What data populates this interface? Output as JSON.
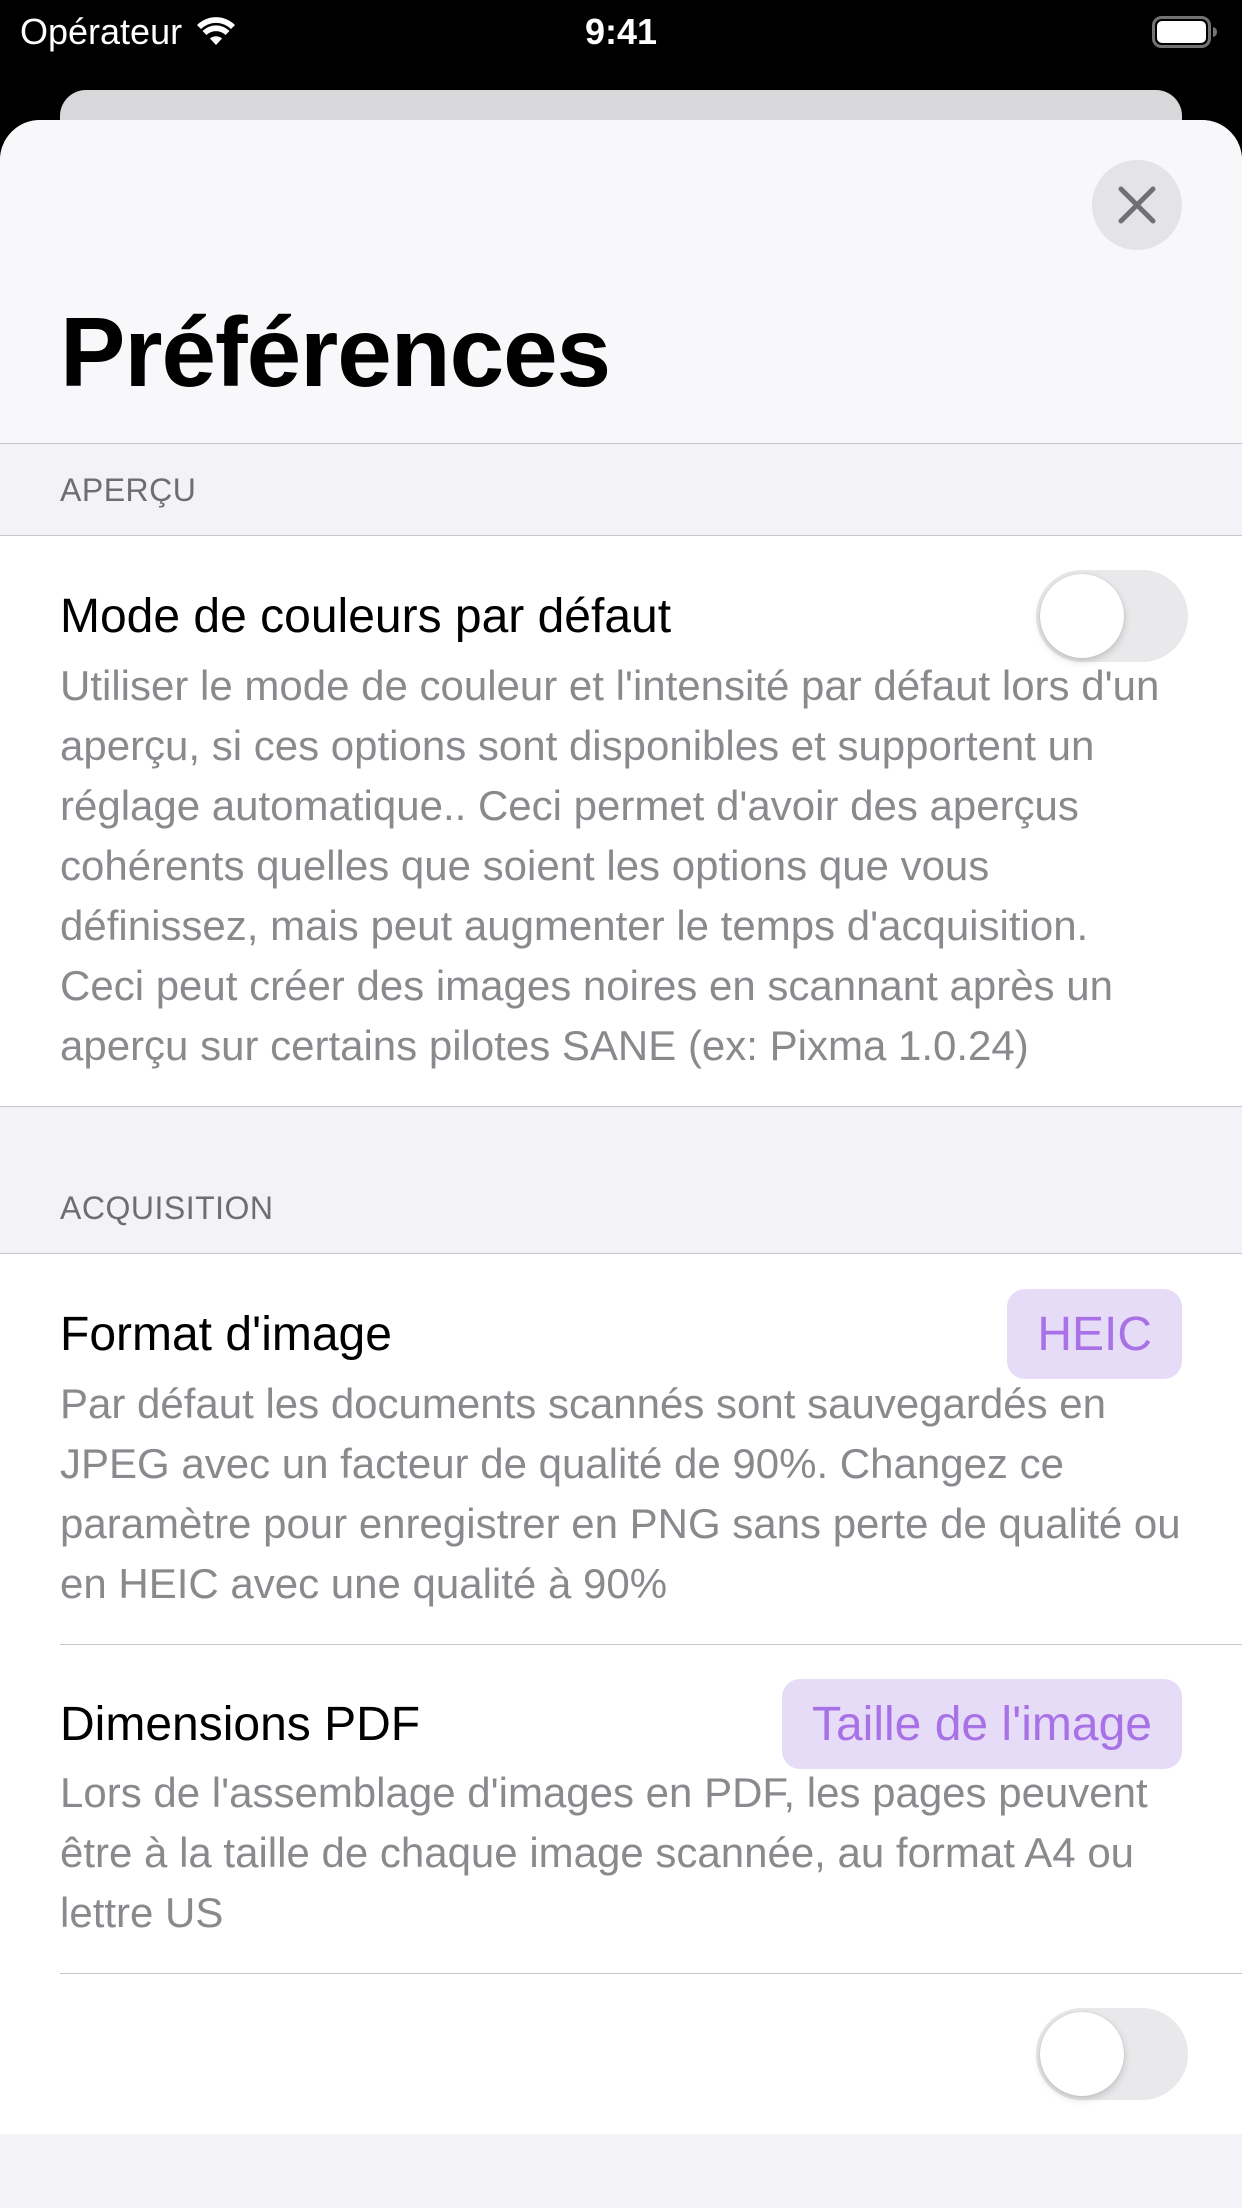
{
  "status_bar": {
    "carrier": "Opérateur",
    "time": "9:41"
  },
  "header": {
    "title": "Préférences",
    "close_icon": "close-icon"
  },
  "sections": {
    "apercu": {
      "header": "APERÇU",
      "default_color_mode": {
        "label": "Mode de couleurs par défaut",
        "enabled": false,
        "description": "Utiliser le mode de couleur et l'intensité par défaut lors d'un aperçu, si ces options sont disponibles et supportent un réglage automatique.. Ceci permet d'avoir des aperçus cohérents quelles que soient les options que vous définissez, mais peut augmenter le temps d'acquisition. Ceci peut créer des images noires en scannant après un aperçu sur certains pilotes SANE (ex: Pixma 1.0.24)"
      }
    },
    "acquisition": {
      "header": "ACQUISITION",
      "image_format": {
        "label": "Format d'image",
        "value": "HEIC",
        "description": "Par défaut les documents scannés sont sauvegardés en JPEG avec un facteur de qualité de 90%. Changez ce paramètre pour enregistrer en PNG sans perte de qualité ou en HEIC avec une qualité à 90%"
      },
      "pdf_dimensions": {
        "label": "Dimensions PDF",
        "value": "Taille de l'image",
        "description": "Lors de l'assemblage d'images en PDF, les pages peuvent être à la taille de chaque image scannée, au format A4 ou lettre US"
      }
    }
  },
  "colors": {
    "accent": "#a872e6",
    "accent_bg": "#e6dcf7",
    "secondary_text": "#8a8a8e",
    "group_bg": "#f2f2f7"
  }
}
